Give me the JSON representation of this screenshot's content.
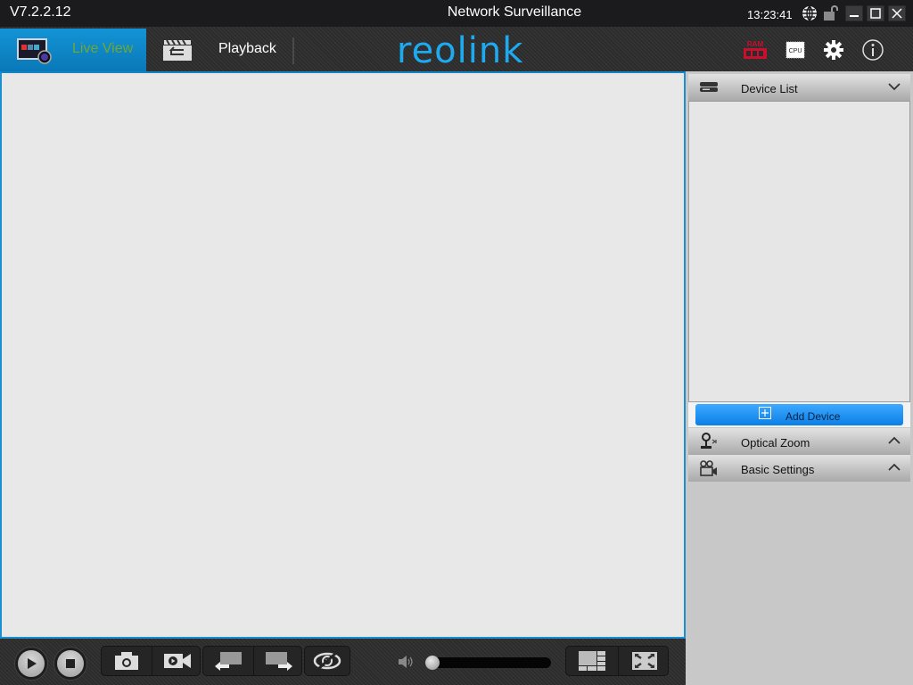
{
  "titlebar": {
    "version": "V7.2.2.12",
    "title": "Network Surveillance",
    "clock": "13:23:41",
    "icons": [
      "globe-icon",
      "unlock-icon",
      "minimize-icon",
      "maximize-icon",
      "close-icon"
    ]
  },
  "toolbar": {
    "tabs": [
      {
        "label": "Live View",
        "icon": "monitor-icon",
        "active": true
      },
      {
        "label": "Playback",
        "icon": "clapperboard-icon",
        "active": false
      }
    ],
    "logo": "reolink",
    "tools": [
      {
        "name": "ram-usage",
        "label": "RAM"
      },
      {
        "name": "cpu-usage",
        "label": "CPU"
      },
      {
        "name": "settings",
        "label": ""
      },
      {
        "name": "info",
        "label": "i"
      }
    ]
  },
  "panel": {
    "device_list": {
      "title": "Device List",
      "expanded": true,
      "devices": []
    },
    "add_device": {
      "label": "Add Device"
    },
    "optical_zoom": {
      "title": "Optical Zoom",
      "expanded": false
    },
    "basic_settings": {
      "title": "Basic Settings",
      "expanded": false
    }
  },
  "bottombar": {
    "controls": [
      "play",
      "stop",
      "snapshot",
      "record",
      "previous-page",
      "next-page",
      "sync-playback"
    ],
    "volume": {
      "value_percent": 0,
      "muted": false
    },
    "layout_buttons": [
      "split-layout",
      "fullscreen"
    ]
  },
  "colors": {
    "accent": "#1394d6",
    "active_tab_text": "#6fa832",
    "logo": "#1eaaf1",
    "ram_icon": "#c8102e",
    "add_device_button": "#1e8ff0"
  }
}
